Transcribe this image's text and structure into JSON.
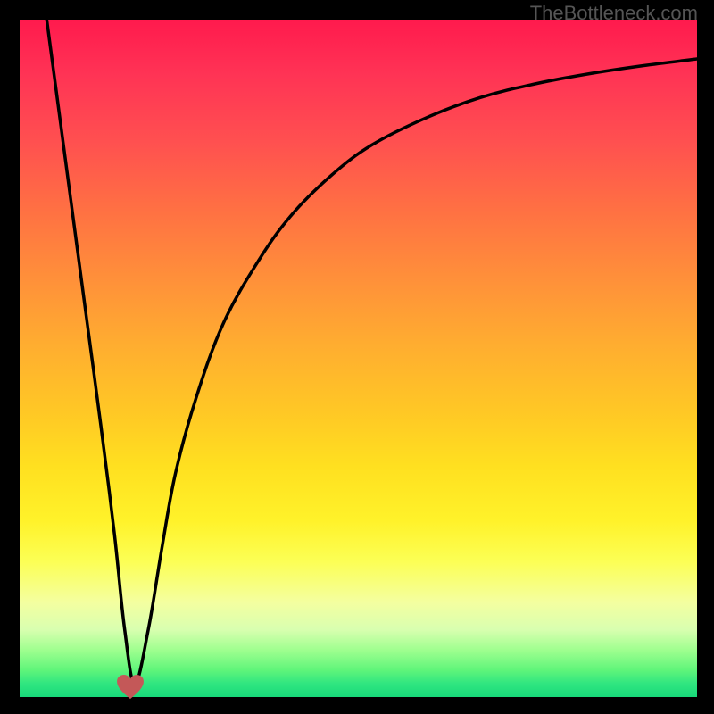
{
  "watermark": "TheBottleneck.com",
  "chart_data": {
    "type": "line",
    "title": "",
    "xlabel": "",
    "ylabel": "",
    "xlim": [
      0,
      100
    ],
    "ylim": [
      0,
      100
    ],
    "grid": false,
    "legend": false,
    "series": [
      {
        "name": "bottleneck-curve",
        "x": [
          4,
          6,
          8,
          10,
          12,
          14,
          15.5,
          17,
          19,
          21,
          23,
          26,
          30,
          35,
          40,
          46,
          52,
          60,
          68,
          76,
          84,
          92,
          100
        ],
        "y": [
          100,
          85,
          70,
          55,
          40,
          24,
          10,
          2,
          10,
          22,
          33,
          44,
          55,
          64,
          71,
          77,
          81.5,
          85.5,
          88.5,
          90.5,
          92,
          93.2,
          94.2
        ]
      }
    ],
    "marker": {
      "x": 16.3,
      "y": 1.4,
      "name": "heart-min"
    },
    "colors": {
      "curve": "#000000",
      "heart": "#c45858"
    }
  }
}
